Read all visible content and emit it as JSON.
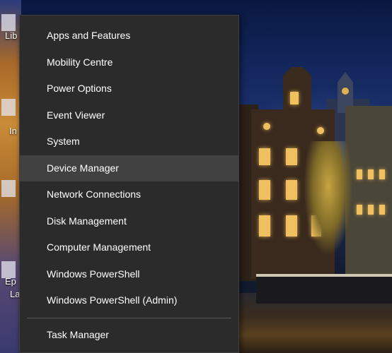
{
  "desktop": {
    "icon_labels": [
      "Lib",
      "In",
      "Ep",
      "La"
    ]
  },
  "menu": {
    "items": [
      {
        "label": "Apps and Features"
      },
      {
        "label": "Mobility Centre"
      },
      {
        "label": "Power Options"
      },
      {
        "label": "Event Viewer"
      },
      {
        "label": "System"
      },
      {
        "label": "Device Manager",
        "highlighted": true
      },
      {
        "label": "Network Connections"
      },
      {
        "label": "Disk Management"
      },
      {
        "label": "Computer Management"
      },
      {
        "label": "Windows PowerShell"
      },
      {
        "label": "Windows PowerShell (Admin)"
      }
    ],
    "footer_item": {
      "label": "Task Manager"
    }
  },
  "colors": {
    "menu_background": "#2b2b2b",
    "menu_hover": "#414141",
    "menu_text": "#ffffff",
    "separator": "#595959"
  }
}
